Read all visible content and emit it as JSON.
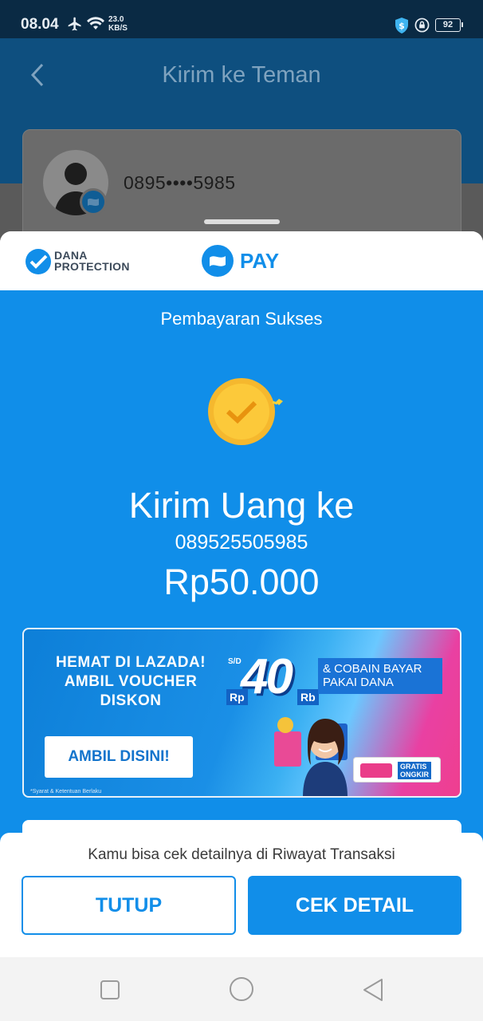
{
  "status_bar": {
    "time": "08.04",
    "speed_value": "23.0",
    "speed_unit": "KB/S",
    "battery": "92",
    "icons": [
      "airplane-icon",
      "wifi-icon",
      "shield-dollar-icon",
      "lock-icon"
    ]
  },
  "background_page": {
    "title": "Kirim ke Teman",
    "recipient_phone_masked": "0895••••5985"
  },
  "sheet": {
    "dana_protection": {
      "line1": "DANA",
      "line2": "PROTECTION"
    },
    "pay_label": "PAY",
    "status_title": "Pembayaran Sukses",
    "heading": "Kirim Uang ke",
    "recipient_phone": "089525505985",
    "amount": "Rp50.000"
  },
  "banner": {
    "headline_lines": [
      "HEMAT DI LAZADA!",
      "AMBIL VOUCHER",
      "DISKON"
    ],
    "button_label": "AMBIL DISINI!",
    "fine_print": "*Syarat & Ketentuan Berlaku",
    "sd_label": "S/D",
    "big_number": "40",
    "rp_label": "Rp",
    "rb_label": "Rb",
    "tagline": "& COBAIN BAYAR PAKAI DANA",
    "badge_lines": [
      "GRATIS",
      "ONGKIR"
    ]
  },
  "bottom_panel": {
    "info": "Kamu bisa cek detailnya di Riwayat Transaksi",
    "close_label": "TUTUP",
    "detail_label": "CEK DETAIL"
  },
  "colors": {
    "primary_blue": "#108ee9",
    "status_bar": "#0a2a44",
    "coin_gold": "#f5b82e"
  }
}
